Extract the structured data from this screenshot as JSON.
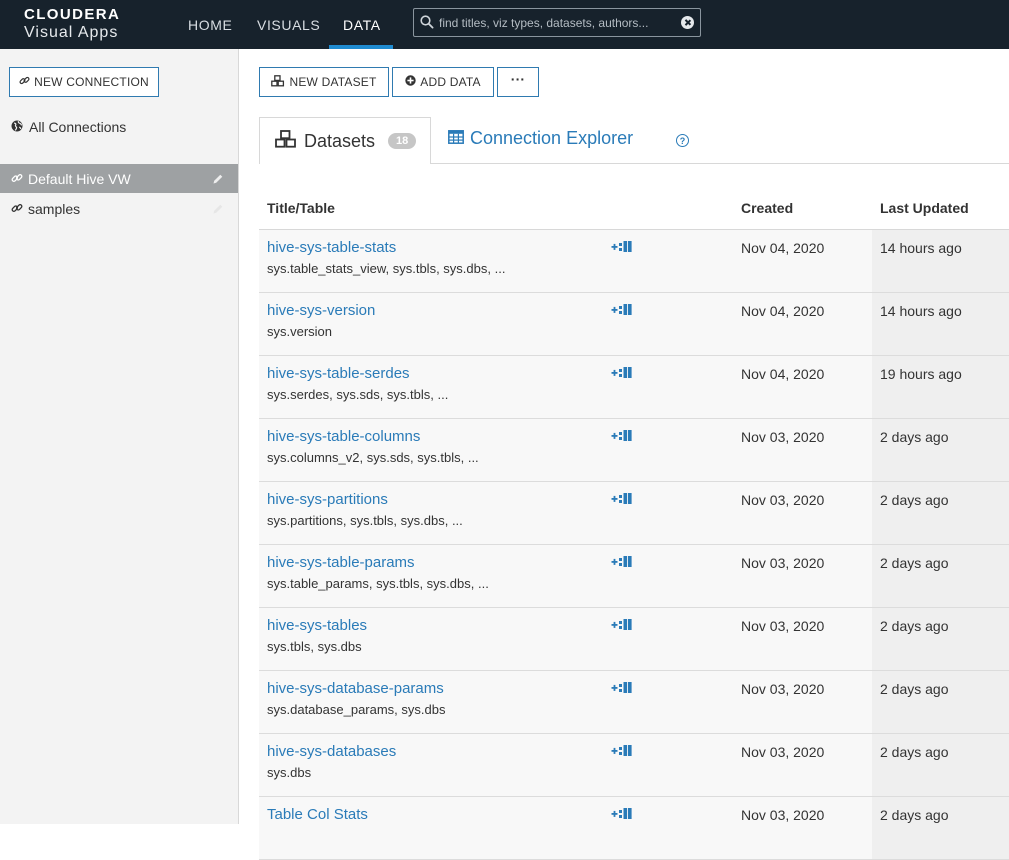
{
  "brand": {
    "line1": "CLOUDERA",
    "line2": "Visual Apps"
  },
  "nav": {
    "home": "HOME",
    "visuals": "VISUALS",
    "data": "DATA"
  },
  "search": {
    "placeholder": "find titles, viz types, datasets, authors..."
  },
  "sidebar": {
    "new_connection": "NEW CONNECTION",
    "all_connections": "All Connections",
    "items": [
      {
        "label": "Default Hive VW",
        "active": true
      },
      {
        "label": "samples",
        "active": false
      }
    ]
  },
  "toolbar": {
    "new_dataset": "NEW DATASET",
    "add_data": "ADD DATA",
    "more": "···"
  },
  "tabs": {
    "datasets": "Datasets",
    "datasets_count": "18",
    "connection_explorer": "Connection Explorer"
  },
  "table": {
    "headers": {
      "title": "Title/Table",
      "created": "Created",
      "updated": "Last Updated"
    },
    "rows": [
      {
        "title": "hive-sys-table-stats",
        "tables": "sys.table_stats_view, sys.tbls, sys.dbs, ...",
        "created": "Nov 04, 2020",
        "updated": "14 hours ago"
      },
      {
        "title": "hive-sys-version",
        "tables": "sys.version",
        "created": "Nov 04, 2020",
        "updated": "14 hours ago"
      },
      {
        "title": "hive-sys-table-serdes",
        "tables": "sys.serdes, sys.sds, sys.tbls, ...",
        "created": "Nov 04, 2020",
        "updated": "19 hours ago"
      },
      {
        "title": "hive-sys-table-columns",
        "tables": "sys.columns_v2, sys.sds, sys.tbls, ...",
        "created": "Nov 03, 2020",
        "updated": "2 days ago"
      },
      {
        "title": "hive-sys-partitions",
        "tables": "sys.partitions, sys.tbls, sys.dbs, ...",
        "created": "Nov 03, 2020",
        "updated": "2 days ago"
      },
      {
        "title": "hive-sys-table-params",
        "tables": "sys.table_params, sys.tbls, sys.dbs, ...",
        "created": "Nov 03, 2020",
        "updated": "2 days ago"
      },
      {
        "title": "hive-sys-tables",
        "tables": "sys.tbls, sys.dbs",
        "created": "Nov 03, 2020",
        "updated": "2 days ago"
      },
      {
        "title": "hive-sys-database-params",
        "tables": "sys.database_params, sys.dbs",
        "created": "Nov 03, 2020",
        "updated": "2 days ago"
      },
      {
        "title": "hive-sys-databases",
        "tables": "sys.dbs",
        "created": "Nov 03, 2020",
        "updated": "2 days ago"
      },
      {
        "title": "Table Col Stats",
        "tables": "",
        "created": "Nov 03, 2020",
        "updated": "2 days ago"
      }
    ]
  },
  "colors": {
    "topbar": "#17222c",
    "accent": "#2a7bb8",
    "active_item": "#9ea1a3"
  }
}
